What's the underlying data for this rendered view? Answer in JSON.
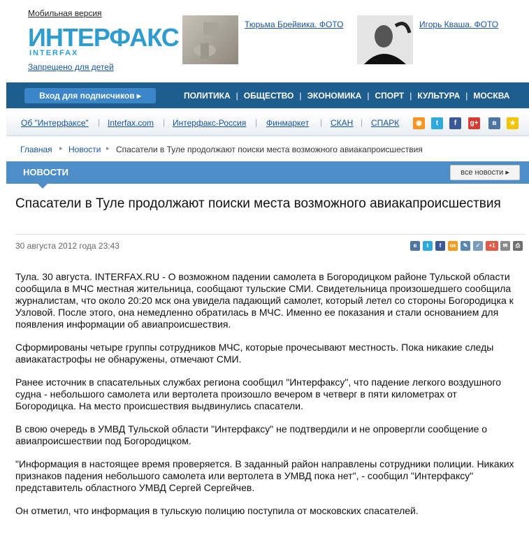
{
  "header": {
    "mobile_version": "Мобильная версия",
    "logo_main": "ИНТЕРФАКС",
    "logo_sub": "INTERFAX",
    "adult_notice": "Запрещено для детей",
    "teasers": [
      {
        "label": "Тюрьма Брейвика. ФОТО"
      },
      {
        "label": "Игорь Кваша. ФОТО"
      }
    ]
  },
  "nav": {
    "login": "Вход для подписчиков ▸",
    "items": [
      "ПОЛИТИКА",
      "ОБЩЕСТВО",
      "ЭКОНОМИКА",
      "СПОРТ",
      "КУЛЬТУРА",
      "МОСКВА"
    ],
    "separator": "|"
  },
  "sublinks": [
    "Об \"Интерфаксе\"",
    "Interfax.com",
    "Интерфакс-Россия",
    "Финмаркет",
    "СКАН",
    "СПАРК"
  ],
  "social_icons": [
    {
      "name": "rss-icon",
      "color": "#f7931e",
      "glyph": "◉"
    },
    {
      "name": "twitter-icon",
      "color": "#2fa8dc",
      "glyph": "t"
    },
    {
      "name": "facebook-icon",
      "color": "#3b5998",
      "glyph": "f"
    },
    {
      "name": "google-plus-icon",
      "color": "#d73d32",
      "glyph": "g+"
    },
    {
      "name": "vkontakte-icon",
      "color": "#4c75a3",
      "glyph": "в"
    },
    {
      "name": "favorite-star-icon",
      "color": "#f5c400",
      "glyph": "★"
    }
  ],
  "breadcrumb": {
    "home": "Главная",
    "section": "Новости",
    "current": "Спасатели в Туле продолжают поиски места возможного авиакапроисшествия"
  },
  "section": {
    "title": "НОВОСТИ",
    "all_news": "все новости ▸"
  },
  "article": {
    "headline": "Спасатели в Туле продолжают поиски места возможного авиакапроисшествия",
    "date": "30 августа 2012 года 23:43",
    "paragraphs": [
      "Тула. 30 августа. INTERFAX.RU - О возможном падении самолета в Богородицком районе Тульской области сообщила в МЧС местная жительница, сообщают тульские СМИ. Свидетельница произошедшего сообщила журналистам, что около 20:20 мск она увидела падающий самолет, который летел со стороны Богородицка к Узловой. После этого, она немедленно обратилась в МЧС. Именно ее показания и стали основанием для появления информации об авиапроисшествия.",
      "Сформированы четыре группы сотрудников МЧС, которые прочесывают местность. Пока никакие следы авиакатастрофы не обнаружены, отмечают СМИ.",
      "Ранее источник в спасательных службах региона сообщил \"Интерфаксу\", что падение легкого воздушного судна - небольшого самолета или вертолета произошло вечером в четверг в пяти километрах от Богородицка. На место происшествия выдвинулись спасатели.",
      "В свою очередь в УМВД Тульской области \"Интерфаксу\" не подтвердили и не опровергли сообщение о авиапроисшествии под Богородицком.",
      "\"Информация в настоящее время проверяется. В заданный район направлены сотрудники полиции. Никаких признаков падения небольшого самолета или вертолета в УМВД пока нет\", - сообщил \"Интерфаксу\" представитель областного УМВД Сергей Сергейчев.",
      "Он отметил, что информация в тульскую полицию поступила от московских спасателей."
    ]
  },
  "share_icons": [
    {
      "name": "vk-share-icon",
      "color": "#4c75a3",
      "glyph": "в"
    },
    {
      "name": "twitter-share-icon",
      "color": "#2fa8dc",
      "glyph": "t"
    },
    {
      "name": "facebook-share-icon",
      "color": "#3b5998",
      "glyph": "f"
    },
    {
      "name": "odnoklassniki-share-icon",
      "color": "#f59a21",
      "glyph": "ок"
    },
    {
      "name": "livejournal-share-icon",
      "color": "#5a88b5",
      "glyph": "✎"
    },
    {
      "name": "bookmark-share-icon",
      "color": "#7d9bbb",
      "glyph": "✓"
    },
    {
      "name": "google-plusone-icon",
      "color": "#e05a47",
      "glyph": "+1"
    },
    {
      "name": "email-icon",
      "color": "#8a8a8a",
      "glyph": "✉"
    },
    {
      "name": "print-icon",
      "color": "#6f6f6f",
      "glyph": "⎙"
    }
  ]
}
